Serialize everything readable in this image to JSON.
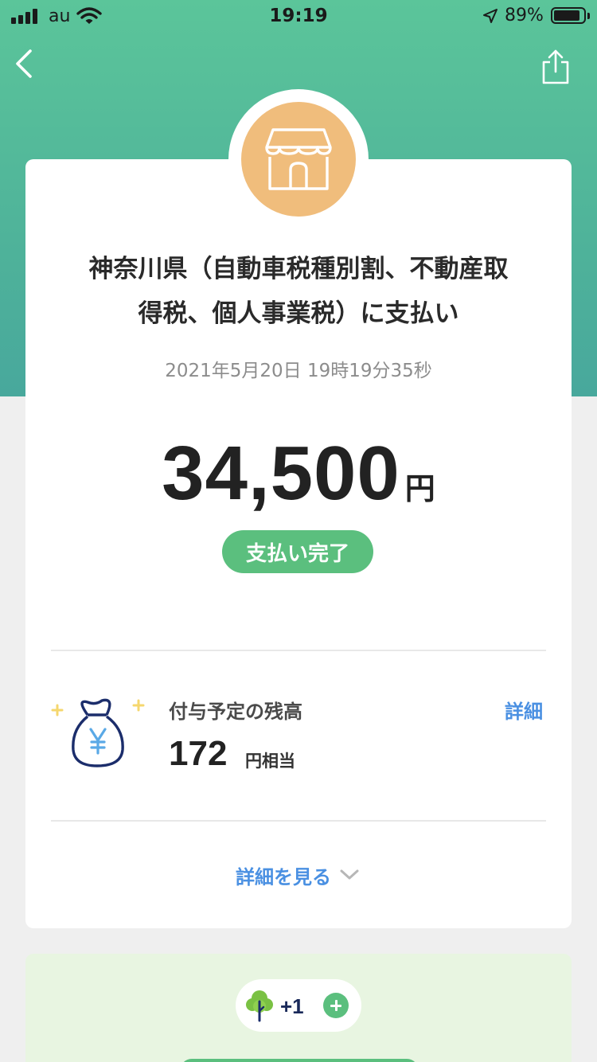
{
  "status_bar": {
    "carrier": "au",
    "time": "19:19",
    "battery_percent": "89%",
    "battery_level": 0.89,
    "icons": [
      "signal-icon",
      "wifi-icon",
      "location-arrow-icon",
      "battery-icon"
    ]
  },
  "nav": {
    "back_icon": "chevron-left-icon",
    "share_icon": "share-icon"
  },
  "payment": {
    "merchant_icon": "store-icon",
    "merchant_icon_color": "#f0bd7c",
    "title_line1": "神奈川県（自動車税種別割、不動産取",
    "title_line2": "得税、個人事業税）に支払い",
    "datetime": "2021年5月20日 19時19分35秒",
    "amount": "34,500",
    "amount_unit": "円",
    "status": "支払い完了",
    "status_color": "#5bbf7e"
  },
  "points": {
    "icon": "money-bag-yen-icon",
    "label": "付与予定の残高",
    "value": "172",
    "unit": "円相当",
    "detail_link": "詳細"
  },
  "see_more": {
    "label": "詳細を見る",
    "icon": "chevron-down-icon"
  },
  "eco": {
    "icon": "tree-icon",
    "count": "+1",
    "add_icon": "plus-circle-icon"
  },
  "colors": {
    "header_green": "#5bc59a",
    "accent_blue": "#4a90e2",
    "eco_bg": "#e8f5e1"
  }
}
